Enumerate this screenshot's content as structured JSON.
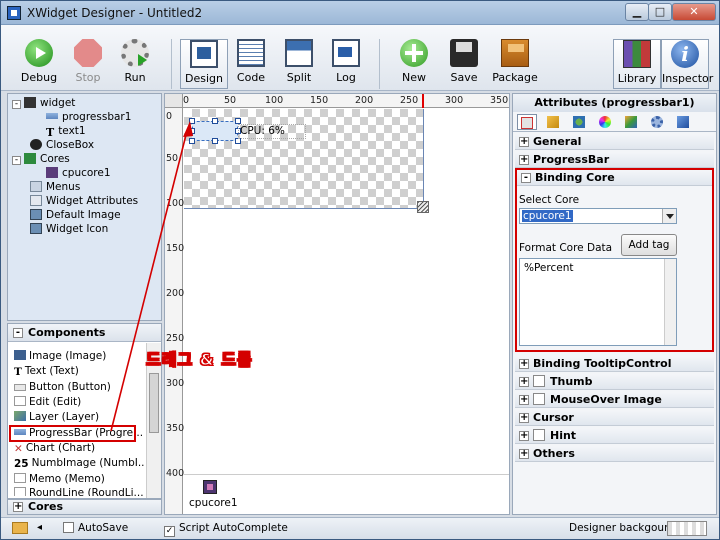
{
  "window": {
    "title": "XWidget Designer - Untitled2",
    "min_label": "▁",
    "max_label": "□",
    "close_label": "✕"
  },
  "toolbar": {
    "debug": "Debug",
    "stop": "Stop",
    "run": "Run",
    "design": "Design",
    "code": "Code",
    "split": "Split",
    "log": "Log",
    "new": "New",
    "save": "Save",
    "package": "Package",
    "library": "Library",
    "inspector": "Inspector",
    "active_view": "Design",
    "stop_enabled": false
  },
  "tree": {
    "items": [
      {
        "label": "widget",
        "icon": "widget-icon",
        "expander": "-"
      },
      {
        "label": "progressbar1",
        "icon": "progressbar-icon"
      },
      {
        "label": "text1",
        "icon": "text-icon",
        "icon_glyph": "T"
      },
      {
        "label": "CloseBox",
        "icon": "close-icon"
      },
      {
        "label": "Cores",
        "icon": "cores-icon",
        "expander": "-"
      },
      {
        "label": "cpucore1",
        "icon": "cpu-core-icon"
      },
      {
        "label": "Menus",
        "icon": "menu-icon"
      },
      {
        "label": "Widget Attributes",
        "icon": "attributes-icon"
      },
      {
        "label": "Default Image",
        "icon": "image-icon"
      },
      {
        "label": "Widget Icon",
        "icon": "image-icon"
      }
    ]
  },
  "components": {
    "header": "Components",
    "header_toggle": "-",
    "items": [
      {
        "label": "Image (Image)",
        "icon": "image-icon"
      },
      {
        "label": "Text (Text)",
        "icon": "text-icon",
        "icon_glyph": "T"
      },
      {
        "label": "Button (Button)",
        "icon": "button-icon"
      },
      {
        "label": "Edit (Edit)",
        "icon": "edit-icon"
      },
      {
        "label": "Layer (Layer)",
        "icon": "layer-icon"
      },
      {
        "label": "ProgressBar (Progre...",
        "icon": "progressbar-icon"
      },
      {
        "label": "Chart (Chart)",
        "icon": "chart-icon",
        "icon_glyph": "✕"
      },
      {
        "label": "NumbImage (NumbI...",
        "icon": "numbimage-icon",
        "icon_glyph": "25"
      },
      {
        "label": "Memo (Memo)",
        "icon": "memo-icon"
      },
      {
        "label": "RoundLine (RoundLi...",
        "icon": "roundline-icon"
      }
    ],
    "highlighted": "ProgressBar (Progre..."
  },
  "cores_panel": {
    "label": "Cores",
    "toggle": "+"
  },
  "canvas": {
    "ruler_top": [
      "0",
      "50",
      "100",
      "150",
      "200",
      "250",
      "300",
      "350"
    ],
    "ruler_left": [
      "0",
      "50",
      "100",
      "150",
      "200",
      "250",
      "300",
      "350",
      "400"
    ],
    "cpu_label": "CPU: 6%",
    "core_item_label": "cpucore1",
    "core_item_icon": "cpu-core-icon"
  },
  "annotation": {
    "text": "드래그 & 드롭",
    "color": "#d40000"
  },
  "inspector": {
    "title": "Attributes (progressbar1)",
    "tabs": [
      "general-tab-icon",
      "ruler-icon",
      "shapes-icon",
      "color-wheel-icon",
      "cube-icon",
      "gear-icon",
      "box-icon"
    ],
    "sections": [
      {
        "label": "General",
        "toggle": "+"
      },
      {
        "label": "ProgressBar",
        "toggle": "+"
      },
      {
        "label": "Binding Core",
        "toggle": "-"
      },
      {
        "label": "Binding TooltipControl",
        "toggle": "+"
      },
      {
        "label": "Thumb",
        "toggle": "+",
        "checkbox": true
      },
      {
        "label": "MouseOver Image",
        "toggle": "+",
        "checkbox": true
      },
      {
        "label": "Cursor",
        "toggle": "+"
      },
      {
        "label": "Hint",
        "toggle": "+",
        "checkbox": true
      },
      {
        "label": "Others",
        "toggle": "+"
      }
    ],
    "binding_core": {
      "select_core_label": "Select Core",
      "select_core_value": "cpucore1",
      "format_label": "Format Core Data",
      "add_tag_label": "Add tag",
      "format_value": "%Percent"
    }
  },
  "statusbar": {
    "autosave_label": "AutoSave",
    "autosave_checked": false,
    "script_autocomplete_label": "Script AutoComplete",
    "script_autocomplete_checked": true,
    "designer_bg_label": "Designer backgound",
    "check_glyph": "✓"
  },
  "colors": {
    "accent": "#3169c6",
    "highlight_red": "#d40000",
    "titlebar": "#9cb8d7"
  }
}
